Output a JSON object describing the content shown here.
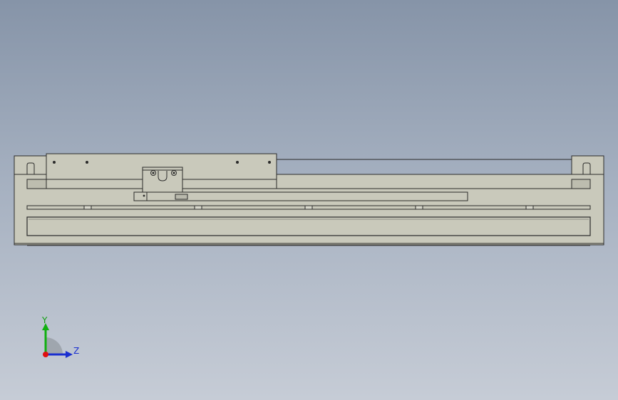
{
  "viewport": {
    "background_top": "#8694a8",
    "background_bottom": "#c6ccd6"
  },
  "model": {
    "name": "linear-module-side-view",
    "body_fill": "#c9c9bb",
    "body_fill_dark": "#b3b3a6",
    "edge_color": "#2a2a2a"
  },
  "triad": {
    "y_label": "Y",
    "z_label": "Z",
    "y_color": "#10b010",
    "z_color": "#1a2fd0",
    "origin_color": "#e01010"
  }
}
